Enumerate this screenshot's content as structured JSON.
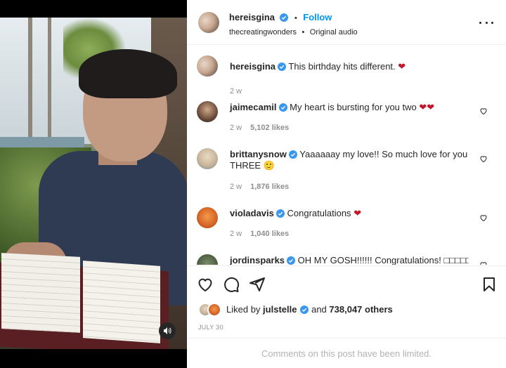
{
  "post": {
    "author": "hereisgina",
    "follow_label": "Follow",
    "separator": "•",
    "audio_account": "thecreatingwonders",
    "audio_sep": "•",
    "audio_label": "Original audio",
    "caption": "This birthday hits different.",
    "caption_time": "2 w"
  },
  "comments": [
    {
      "user": "jaimecamil",
      "text": "My heart is bursting for you two",
      "time": "2 w",
      "likes": "5,102 likes",
      "emoji": "❤❤"
    },
    {
      "user": "brittanysnow",
      "text": "Yaaaaaay my love!! So much love for you THREE",
      "time": "2 w",
      "likes": "1,876 likes",
      "emoji": "🙂"
    },
    {
      "user": "violadavis",
      "text": "Congratulations",
      "time": "2 w",
      "likes": "1,040 likes",
      "emoji": "❤"
    },
    {
      "user": "jordinsparks",
      "text": "OH MY GOSH!!!!!! Congratulations! □□□□□□"
    }
  ],
  "likes": {
    "prefix": "Liked by",
    "user": "julstelle",
    "suffix": "and",
    "count": "738,047 others"
  },
  "date": "JULY 30",
  "footer": "Comments on this post have been limited.",
  "colors": {
    "accent": "#0095f6",
    "verified": "#3897f0",
    "heart": "#ed4956"
  }
}
